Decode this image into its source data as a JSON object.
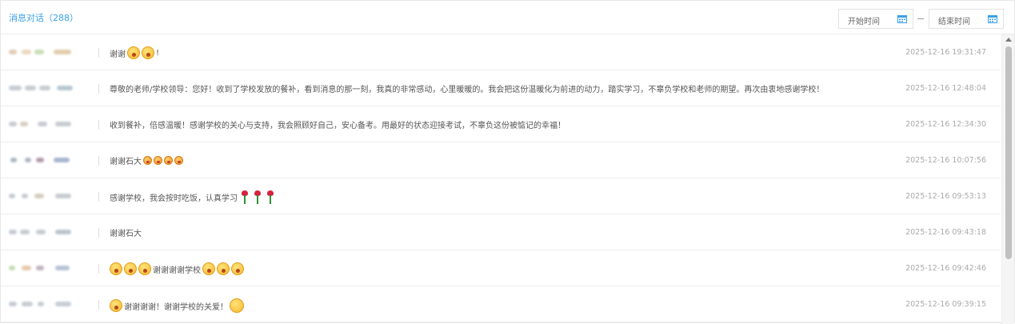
{
  "header": {
    "title": "消息对话（288）",
    "start_placeholder": "开始时间",
    "end_placeholder": "结束时间",
    "accent_color": "#3aa0e8"
  },
  "messages": [
    {
      "text": [
        "谢谢",
        "!"
      ],
      "emojis": [
        "astonished-face",
        "astonished-face"
      ],
      "time": "2025-12-16 19:31:47"
    },
    {
      "text": [
        "尊敬的老师/学校领导：您好！收到了学校发放的餐补，看到消息的那一刻，我真的非常感动，心里暖暖的。我会把这份温暖化为前进的动力，踏实学习，不辜负学校和老师的期望。再次由衷地感谢学校！"
      ],
      "time": "2025-12-16 12:48:04"
    },
    {
      "text": [
        "收到餐补，倍感温暖！感谢学校的关心与支持，我会照顾好自己，安心备考。用最好的状态迎接考试，不辜负这份被惦记的幸福！"
      ],
      "time": "2025-12-16 12:34:30"
    },
    {
      "text": [
        "谢谢石大"
      ],
      "emojis": [
        "blushing-face",
        "blushing-face",
        "blushing-face",
        "blushing-face"
      ],
      "time": "2025-12-16 10:07:56"
    },
    {
      "text": [
        "感谢学校，我会按时吃饭，认真学习"
      ],
      "emojis": [
        "rose",
        "rose",
        "rose"
      ],
      "time": "2025-12-16 09:53:13"
    },
    {
      "text": [
        "谢谢石大"
      ],
      "time": "2025-12-16 09:43:18"
    },
    {
      "text": [
        "谢谢谢谢学校"
      ],
      "emojis": [
        "astonished-face",
        "astonished-face",
        "astonished-face",
        "astonished-face",
        "astonished-face",
        "astonished-face"
      ],
      "time": "2025-12-16 09:42:46"
    },
    {
      "text": [
        "谢谢谢谢！谢谢学校的关爱！"
      ],
      "emojis": [
        "astonished-face",
        "grinning-face"
      ],
      "time": "2025-12-16 09:39:15"
    }
  ]
}
